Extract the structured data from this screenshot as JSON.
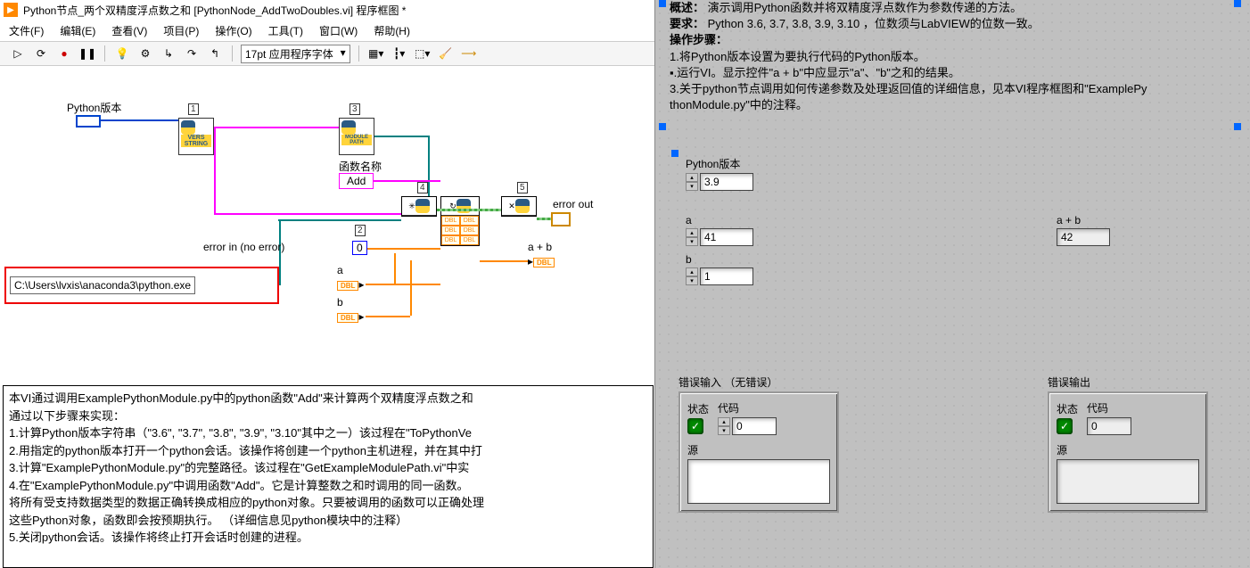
{
  "window": {
    "title": "Python节点_两个双精度浮点数之和 [PythonNode_AddTwoDoubles.vi] 程序框图 *"
  },
  "menu": {
    "file": "文件(F)",
    "edit": "编辑(E)",
    "view": "查看(V)",
    "project": "项目(P)",
    "operate": "操作(O)",
    "tools": "工具(T)",
    "window": "窗口(W)",
    "help": "帮助(H)"
  },
  "toolbar": {
    "font": "17pt 应用程序字体"
  },
  "diagram": {
    "python_version_label": "Python版本",
    "version_node_idx": "1",
    "version_node_text": "VERS\nSTRING",
    "module_node_idx": "3",
    "module_node_text": "MODULE\nPATH",
    "func_name_label": "函数名称",
    "func_name_value": "Add",
    "open_node_idx": "4",
    "close_node_idx": "5",
    "error_out_label": "error out",
    "error_in_label": "error in (no error)",
    "num_const_idx": "2",
    "num_const_value": "0",
    "a_label": "a",
    "b_label": "b",
    "a_plus_b_label": "a + b",
    "dbl_text": "DBL",
    "path_value": "C:\\Users\\lvxis\\anaconda3\\python.exe"
  },
  "help": {
    "line0": "本VI通过调用ExamplePythonModule.py中的python函数\"Add\"来计算两个双精度浮点数之和",
    "line1": "通过以下步骤来实现：",
    "line2": "1.计算Python版本字符串（\"3.6\", \"3.7\", \"3.8\", \"3.9\", \"3.10\"其中之一）该过程在\"ToPythonVe",
    "line3": "2.用指定的python版本打开一个python会话。该操作将创建一个python主机进程，并在其中打",
    "line4": "3.计算\"ExamplePythonModule.py\"的完整路径。该过程在\"GetExampleModulePath.vi\"中实",
    "line5": "4.在\"ExamplePythonModule.py\"中调用函数\"Add\"。它是计算整数之和时调用的同一函数。",
    "line6": "将所有受支持数据类型的数据正确转换成相应的python对象。只要被调用的函数可以正确处理",
    "line7": "这些Python对象，函数即会按预期执行。    （详细信息见python模块中的注释）",
    "line8": "5.关闭python会话。该操作将终止打开会话时创建的进程。"
  },
  "front": {
    "overview_label": "概述：",
    "overview_text": "演示调用Python函数并将双精度浮点数作为参数传递的方法。",
    "req_label": "要求：",
    "req_text": "Python 3.6, 3.7, 3.8, 3.9, 3.10 ，位数须与LabVIEW的位数一致。",
    "steps_label": "操作步骤：",
    "step1": "1.将Python版本设置为要执行代码的Python版本。",
    "step2": "▪.运行VI。显示控件\"a + b\"中应显示\"a\"、\"b\"之和的结果。",
    "step3a": "3.关于python节点调用如何传递参数及处理返回值的详细信息，见本VI程序框图和\"ExamplePy",
    "step3b": "thonModule.py\"中的注释。",
    "py_version_label": "Python版本",
    "py_version_value": "3.9",
    "a_label": "a",
    "a_value": "41",
    "b_label": "b",
    "b_value": "1",
    "aplusb_label": "a + b",
    "aplusb_value": "42",
    "error_in_label": "错误输入 （无错误）",
    "error_out_label": "错误输出",
    "status_label": "状态",
    "code_label": "代码",
    "code_value": "0",
    "source_label": "源",
    "check": "✓"
  }
}
